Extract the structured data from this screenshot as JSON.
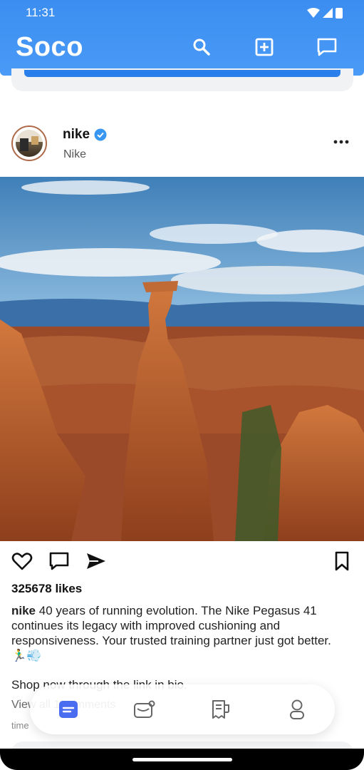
{
  "status": {
    "time": "11:31"
  },
  "app": {
    "title": "Soco"
  },
  "post": {
    "username": "nike",
    "display_name": "Nike",
    "likes": "325678 likes",
    "caption_user": "nike",
    "caption_text": "40 years of running evolution. The Nike Pegasus 41 continues its legacy with improved cushioning and responsiveness. Your trusted training partner just got better. 🏃‍♂️💨",
    "shop_text": "Shop now through the link in bio.",
    "view_comments": "View all 1 comments",
    "time_label": "time"
  },
  "icons": {
    "top": [
      "search-icon",
      "add-post-icon",
      "messages-icon"
    ],
    "post": [
      "heart-icon",
      "comment-icon",
      "share-icon",
      "bookmark-icon"
    ],
    "nav": [
      "feed-icon",
      "inbox-icon",
      "receipt-icon",
      "profile-icon"
    ]
  },
  "colors": {
    "brand": "#3b8ef0",
    "nav_active": "#4a6cf0",
    "verified": "#3897f0"
  }
}
